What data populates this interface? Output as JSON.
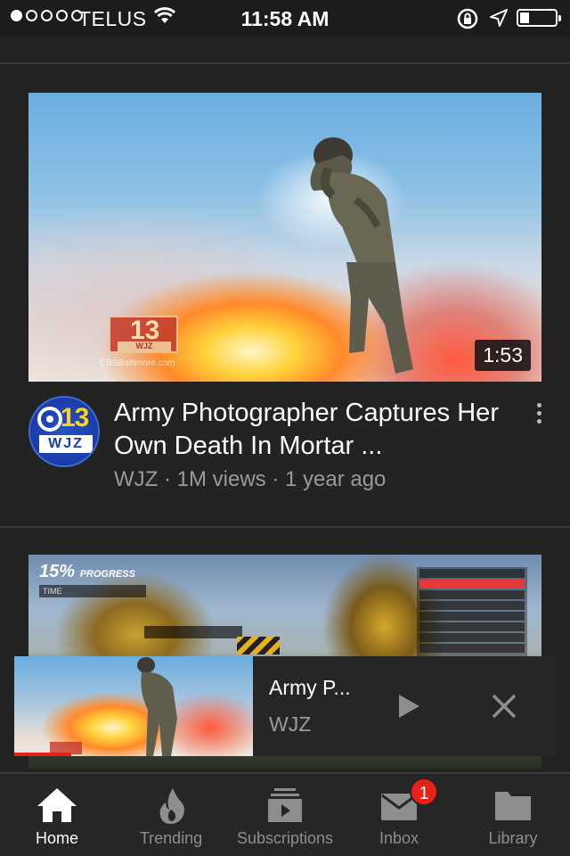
{
  "status_bar": {
    "carrier": "TELUS",
    "time": "11:58 AM",
    "signal_bars_filled": 1,
    "signal_bars_total": 5,
    "battery_level": 0.2,
    "icons": [
      "wifi-icon",
      "rotation-lock-icon",
      "location-arrow-icon",
      "battery-icon"
    ]
  },
  "feed": {
    "videos": [
      {
        "title": "Army Photographer Captures Her Own Death In Mortar ...",
        "channel": "WJZ",
        "meta": "WJZ · 1M views · 1 year ago",
        "duration": "1:53",
        "avatar_number": "13",
        "avatar_call": "WJZ",
        "thumb_logo_number": "13",
        "thumb_logo_call": "WJZ",
        "thumb_url": "CBSBaltimore.com"
      },
      {
        "hud_progress": "15%",
        "hud_progress_label": "PROGRESS",
        "hud_time_label": "TIME"
      }
    ]
  },
  "mini_player": {
    "title": "Army P...",
    "channel": "WJZ",
    "progress": 0.24
  },
  "bottom_nav": {
    "items": [
      {
        "label": "Home",
        "icon": "home-icon",
        "active": true
      },
      {
        "label": "Trending",
        "icon": "flame-icon",
        "active": false
      },
      {
        "label": "Subscriptions",
        "icon": "subscriptions-icon",
        "active": false
      },
      {
        "label": "Inbox",
        "icon": "mail-icon",
        "active": false
      },
      {
        "label": "Library",
        "icon": "folder-icon",
        "active": false
      }
    ],
    "inbox_badge": "1"
  },
  "colors": {
    "background": "#232323",
    "accent_red": "#e62117",
    "text_secondary": "#9a9a9a"
  }
}
